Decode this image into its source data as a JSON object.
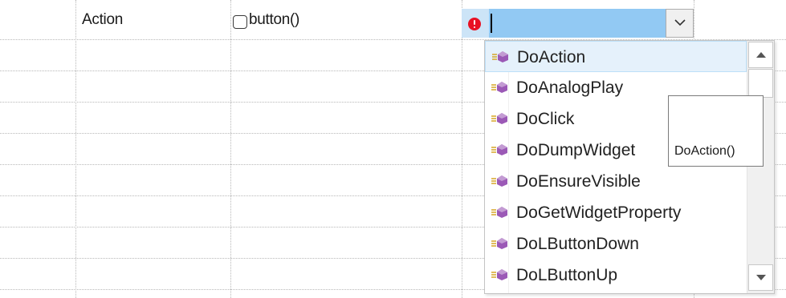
{
  "row": {
    "action_label": "Action",
    "checkbox_label": "button()",
    "combo_value": ""
  },
  "dropdown": {
    "items": [
      {
        "label": "DoAction",
        "selected": true
      },
      {
        "label": "DoAnalogPlay",
        "selected": false
      },
      {
        "label": "DoClick",
        "selected": false
      },
      {
        "label": "DoDumpWidget",
        "selected": false
      },
      {
        "label": "DoEnsureVisible",
        "selected": false
      },
      {
        "label": "DoGetWidgetProperty",
        "selected": false
      },
      {
        "label": "DoLButtonDown",
        "selected": false
      },
      {
        "label": "DoLButtonUp",
        "selected": false
      }
    ],
    "icon": "method-icon"
  },
  "tooltip": {
    "text": "DoAction()"
  },
  "colors": {
    "combo_bg": "#cce4f7",
    "combo_edit_bg": "#92c9f3",
    "error": "#e81123",
    "selected_item_bg": "#e5f1fb",
    "method_icon": "#9b59b6"
  }
}
